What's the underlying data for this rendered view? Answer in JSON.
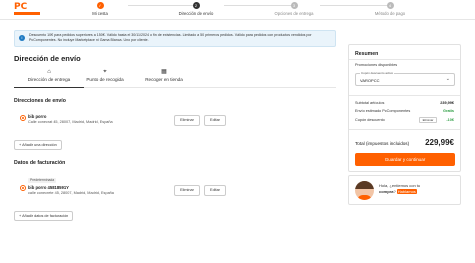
{
  "brand": {
    "logo_text": "PC",
    "accent": "#ff6000"
  },
  "steps": [
    {
      "num": "1",
      "label": "Mi cesta",
      "state": "done"
    },
    {
      "num": "2",
      "label": "Dirección de envío",
      "state": "active"
    },
    {
      "num": "3",
      "label": "Opciones de entrega",
      "state": "pending"
    },
    {
      "num": "4",
      "label": "Método de pago",
      "state": "pending"
    }
  ],
  "info_banner": {
    "icon": "info-icon",
    "text": "Descuento 10€ para pedidos superiores a 150€. Válido hasta el 30/11/2024 o fin de existencias. Limitado a 50 primeros pedidos. Válido para pedidos con productos vendidos por PcComponentes. No incluye Marketplace ni Gama Blanca. Uno por cliente."
  },
  "page_title": "Dirección de envío",
  "tabs": [
    {
      "icon": "home-icon",
      "label": "Dirección de entrega",
      "active": true
    },
    {
      "icon": "location-pin-icon",
      "label": "Punto de recogida",
      "active": false
    },
    {
      "icon": "store-icon",
      "label": "Recoger en tienda",
      "active": false
    }
  ],
  "shipping": {
    "heading": "Direcciones de envío",
    "address": {
      "name": "bib porro",
      "line": "Calle conecrat 45, 28007, Madrid, Madrid, España",
      "remove_label": "Eliminar",
      "edit_label": "Editar"
    },
    "add_label": "+ Añadir una dirección"
  },
  "billing": {
    "heading": "Datos de facturación",
    "badge": "Predeterminada",
    "address": {
      "name": "bib porro 45818591Y",
      "line": "calle conecrete 45, 28007, Madrid, Madrid, España",
      "remove_label": "Eliminar",
      "edit_label": "Editar"
    },
    "add_label": "+ Añadir datos de facturación"
  },
  "summary": {
    "heading": "Resumen",
    "promo_label": "Promociones disponibles",
    "select_label": "Cupón descuento activo",
    "select_value": "VAROPCC",
    "subtotal_label": "Subtotal artículos",
    "subtotal_value": "239,99€",
    "shipping_label": "Envío estimado PcComponentes",
    "shipping_value": "Gratis",
    "coupon_label": "Cupón descuento",
    "coupon_remove": "Eliminar",
    "coupon_value": "-10€",
    "total_label": "Total (impuestos incluidos)",
    "total_value": "229,99€",
    "cta_label": "Guardar y continuar"
  },
  "chat": {
    "greeting": "Hola, ¿entiemos con tu",
    "bold": "compra",
    "highlight": "Hablamos"
  }
}
